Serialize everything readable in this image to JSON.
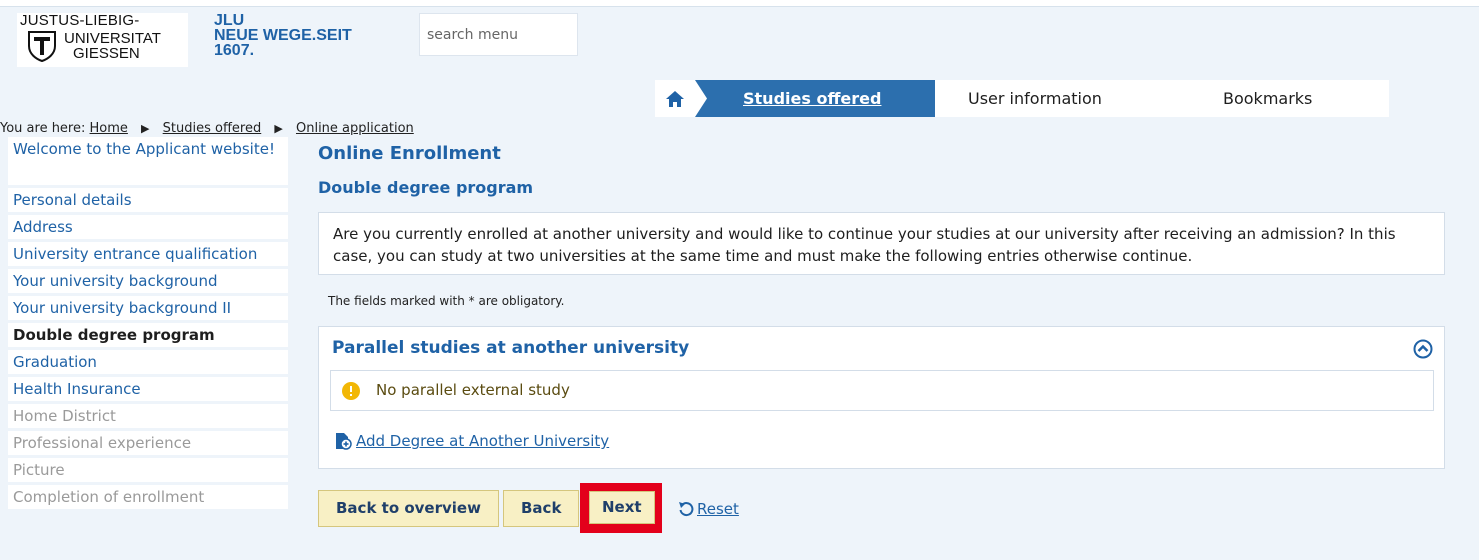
{
  "logo": {
    "line1": "JUSTUS-LIEBIG-",
    "line2": "UNIVERSITAT",
    "line3": "GIESSEN"
  },
  "slogan": {
    "line1": "JLU",
    "line2": "NEUE WEGE.SEIT",
    "line3": "1607."
  },
  "search": {
    "placeholder": "search menu"
  },
  "topnav": {
    "home_icon": "home-icon",
    "active": "Studies offered",
    "items": [
      "User information",
      "Bookmarks"
    ]
  },
  "breadcrumb": {
    "prefix": "You are here:",
    "items": [
      "Home",
      "Studies offered",
      "Online application"
    ]
  },
  "sidebar": {
    "items": [
      {
        "label": "Welcome to the Applicant website!",
        "state": "link"
      },
      {
        "label": "Personal details",
        "state": "link"
      },
      {
        "label": "Address",
        "state": "link"
      },
      {
        "label": "University entrance qualification",
        "state": "link"
      },
      {
        "label": "Your university background",
        "state": "link"
      },
      {
        "label": "Your university background II",
        "state": "link"
      },
      {
        "label": "Double degree program",
        "state": "active"
      },
      {
        "label": "Graduation",
        "state": "link"
      },
      {
        "label": "Health Insurance",
        "state": "link"
      },
      {
        "label": "Home District",
        "state": "disabled"
      },
      {
        "label": "Professional experience",
        "state": "disabled"
      },
      {
        "label": "Picture",
        "state": "disabled"
      },
      {
        "label": "Completion of enrollment",
        "state": "disabled"
      }
    ]
  },
  "main": {
    "title": "Online Enrollment",
    "subtitle": "Double degree program",
    "intro": "Are you currently enrolled at another university and would like to continue your studies at our university after receiving an admission? In this case, you can study at two universities at the same time and must make the following entries otherwise continue.",
    "obligatory_note": "The fields marked with * are obligatory.",
    "panel": {
      "title": "Parallel studies at another university",
      "info": "No parallel external study",
      "add_link": "Add Degree at Another University"
    }
  },
  "buttons": {
    "back_overview": "Back to overview",
    "back": "Back",
    "next": "Next",
    "reset": "Reset"
  },
  "colors": {
    "accent": "#1f62a6",
    "highlight": "#e3001b",
    "button_bg": "#f8f0c5",
    "info": "#f2b705"
  }
}
